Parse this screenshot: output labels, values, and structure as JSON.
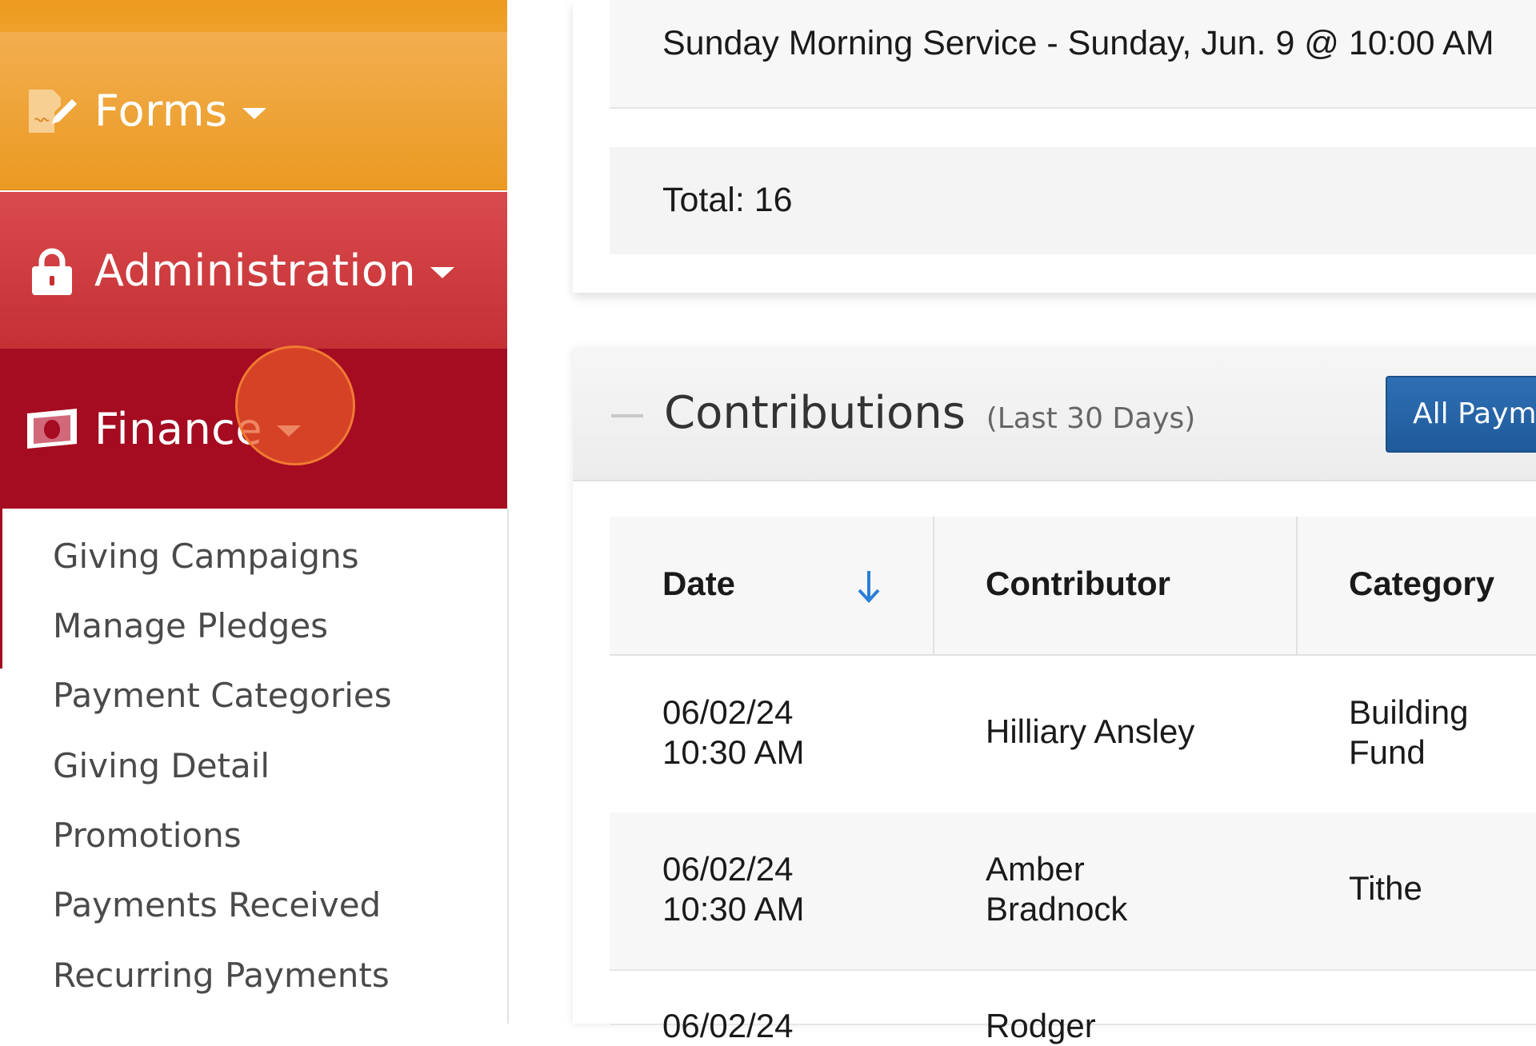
{
  "sidebar": {
    "forms": {
      "label": "Forms",
      "icon": "pencil-document-icon",
      "color": "#eb9a22"
    },
    "administration": {
      "label": "Administration",
      "icon": "lock-icon",
      "color": "#c43034"
    },
    "finance": {
      "label": "Finance",
      "icon": "money-bill-icon",
      "color": "#a50b21"
    },
    "finance_items": [
      "Giving Campaigns",
      "Manage Pledges",
      "Payment Categories",
      "Giving Detail",
      "Promotions",
      "Payments Received",
      "Recurring Payments"
    ]
  },
  "service": {
    "name": "Sunday Morning Service - Sunday, Jun. 9 @ 10:00 AM",
    "total": "Total: 16"
  },
  "contributions": {
    "title": "Contributions",
    "subtitle": "(Last 30 Days)",
    "all_payments_label": "All Payments",
    "accent_color": "#2e6fb4",
    "columns": [
      "Date",
      "Contributor",
      "Category"
    ],
    "rows": [
      {
        "date": "06/02/24",
        "time": "10:30 AM",
        "contributor_first": "Hilliary Ansley",
        "contributor_last": "",
        "category_1": "Building",
        "category_2": "Fund"
      },
      {
        "date": "06/02/24",
        "time": "10:30 AM",
        "contributor_first": "Amber",
        "contributor_last": "Bradnock",
        "category_1": "Tithe",
        "category_2": ""
      },
      {
        "date": "06/02/24",
        "time": "",
        "contributor_first": "Rodger",
        "contributor_last": "",
        "category_1": "",
        "category_2": ""
      }
    ]
  }
}
